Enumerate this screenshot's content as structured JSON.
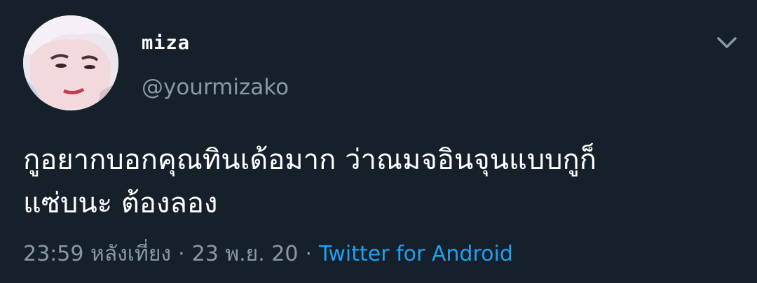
{
  "user": {
    "display_name": "miza",
    "handle": "@yourmizako",
    "avatar_icon": "profile-avatar"
  },
  "menu": {
    "icon": "chevron-down-icon"
  },
  "tweet": {
    "text": "กูอยากบอกคุณทินเด้อมาก ว่าณมจอินจุนแบบกูก็\nแซ่บนะ ต้องลอง",
    "time": "23:59 หลังเที่ยง",
    "separator": "·",
    "date": "23 พ.ย. 20",
    "source": "Twitter for Android"
  },
  "colors": {
    "background": "#15202b",
    "text_primary": "#ffffff",
    "text_secondary": "#8899a6",
    "link": "#1da1f2"
  }
}
